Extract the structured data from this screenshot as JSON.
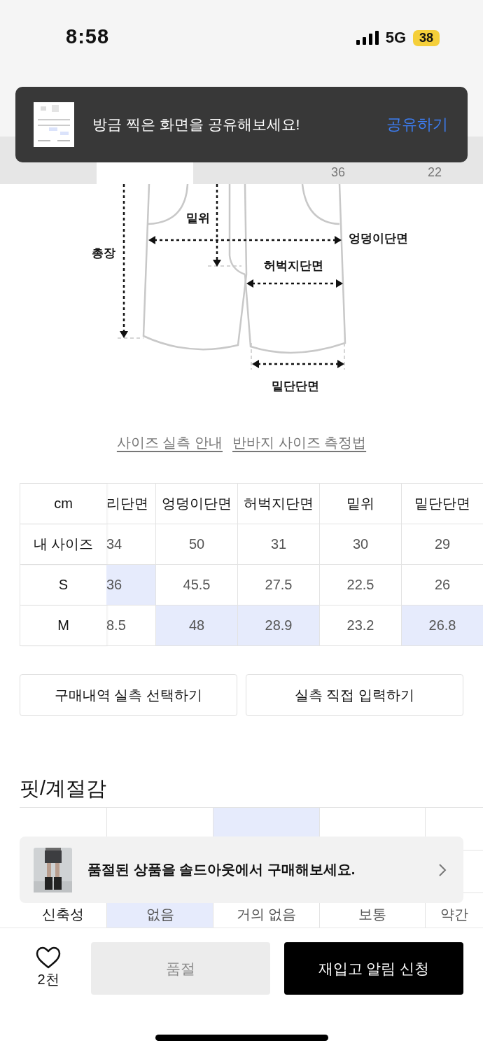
{
  "status_bar": {
    "time": "8:58",
    "network": "5G",
    "battery": "38"
  },
  "toast": {
    "message": "방금 찍은 화면을 공유해보세요!",
    "action": "공유하기"
  },
  "tabs": [
    {
      "selected": false
    },
    {
      "selected": true
    },
    {
      "selected": false
    }
  ],
  "tab_bar_values": [
    "36",
    "22"
  ],
  "diagram": {
    "labels": {
      "length": "총장",
      "rise": "밑위",
      "hip": "엉덩이단면",
      "thigh": "허벅지단면",
      "hem": "밑단단면"
    }
  },
  "links": [
    "사이즈 실측 안내",
    "반바지 사이즈 측정법"
  ],
  "size_table": {
    "corner": "cm",
    "columns": [
      "리단면",
      "엉덩이단면",
      "허벅지단면",
      "밑위",
      "밑단단면"
    ],
    "rows": [
      {
        "label": "내 사이즈",
        "cells": [
          {
            "text": "34",
            "selected": false
          },
          {
            "text": "50",
            "selected": false
          },
          {
            "text": "31",
            "selected": false
          },
          {
            "text": "30",
            "selected": false
          },
          {
            "text": "29",
            "selected": false
          }
        ]
      },
      {
        "label": "S",
        "cells": [
          {
            "text": "36",
            "selected": true
          },
          {
            "text": "45.5",
            "selected": false
          },
          {
            "text": "27.5",
            "selected": false
          },
          {
            "text": "22.5",
            "selected": false
          },
          {
            "text": "26",
            "selected": false
          }
        ]
      },
      {
        "label": "M",
        "cells": [
          {
            "text": "8.5",
            "selected": false
          },
          {
            "text": "48",
            "selected": true
          },
          {
            "text": "28.9",
            "selected": true
          },
          {
            "text": "23.2",
            "selected": false
          },
          {
            "text": "26.8",
            "selected": true
          }
        ]
      }
    ]
  },
  "size_buttons": [
    "구매내역 실측 선택하기",
    "실측 직접 입력하기"
  ],
  "fit_section": {
    "title": "핏/계절감",
    "rows": [
      {
        "cells": [
          {
            "selected": false
          },
          {
            "selected": true
          },
          {
            "selected": false
          },
          {
            "selected": false
          }
        ]
      },
      {
        "label": "신축성",
        "cells": [
          {
            "text": "없음",
            "selected": true
          },
          {
            "text": "거의 없음",
            "selected": false
          },
          {
            "text": "보통",
            "selected": false
          },
          {
            "text": "약간",
            "selected": false
          }
        ]
      }
    ]
  },
  "soldout_banner": {
    "text": "품절된 상품을 솔드아웃에서 구매해보세요."
  },
  "bottom_bar": {
    "likes": "2천",
    "soldout_button": {
      "label": "품절",
      "disabled": true
    },
    "restock_button": "재입고 알림 신청"
  }
}
